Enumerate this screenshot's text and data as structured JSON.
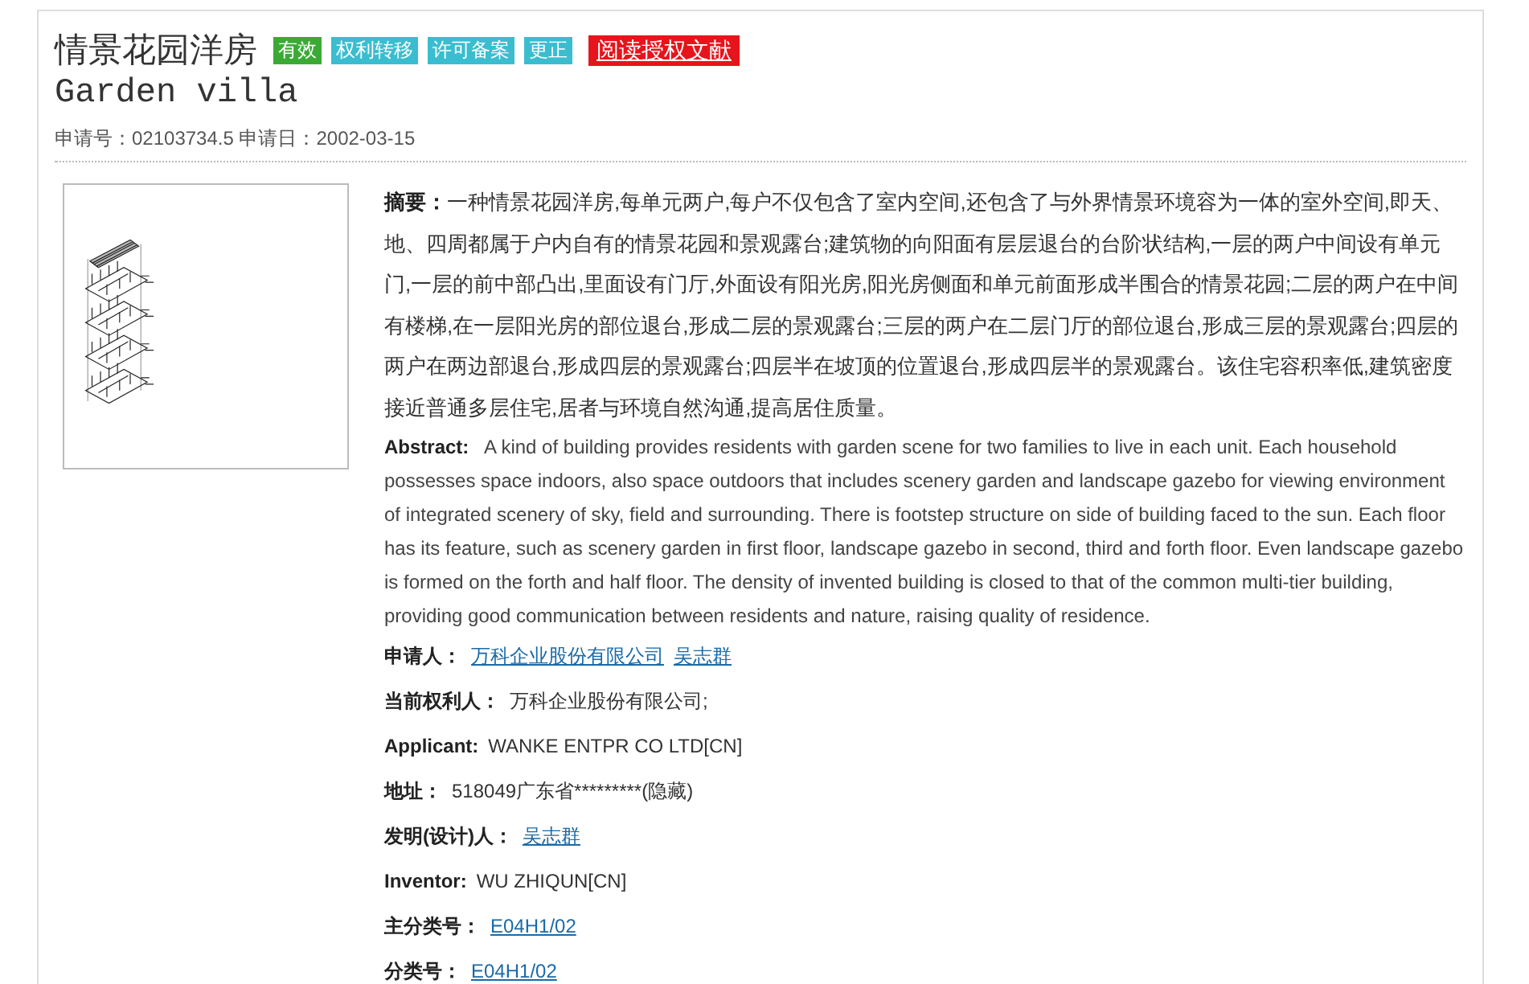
{
  "title": {
    "zh": "情景花园洋房",
    "en": "Garden villa"
  },
  "tags": [
    {
      "label": "有效",
      "color": "#3aaa35",
      "kind": "tag"
    },
    {
      "label": "权利转移",
      "color": "#3bbdd0",
      "kind": "tag"
    },
    {
      "label": "许可备案",
      "color": "#3bbdd0",
      "kind": "tag"
    },
    {
      "label": "更正",
      "color": "#3bbdd0",
      "kind": "tag"
    },
    {
      "label": "阅读授权文献",
      "color": "#e8141c",
      "kind": "link"
    }
  ],
  "meta": "申请号：02103734.5 申请日：2002-03-15",
  "figure": {
    "kind": "drawing"
  },
  "abstract_zh": {
    "label": "摘要：",
    "text": "一种情景花园洋房,每单元两户,每户不仅包含了室内空间,还包含了与外界情景环境容为一体的室外空间,即天、地、四周都属于户内自有的情景花园和景观露台;建筑物的向阳面有层层退台的台阶状结构,一层的两户中间设有单元门,一层的前中部凸出,里面设有门厅,外面设有阳光房,阳光房侧面和单元前面形成半围合的情景花园;二层的两户在中间有楼梯,在一层阳光房的部位退台,形成二层的景观露台;三层的两户在二层门厅的部位退台,形成三层的景观露台;四层的两户在两边部退台,形成四层的景观露台;四层半在坡顶的位置退台,形成四层半的景观露台。该住宅容积率低,建筑密度接近普通多层住宅,居者与环境自然沟通,提高居住质量。"
  },
  "abstract_en": {
    "label": "Abstract:",
    "text": "A kind of building provides residents with garden scene for two families to live in each unit. Each household possesses space indoors, also space outdoors that includes scenery garden and landscape gazebo for viewing environment of integrated scenery of sky, field and surrounding. There is footstep structure on side of building faced to the sun. Each floor has its feature, such as scenery garden in first floor, landscape gazebo in second, third and forth floor. Even landscape gazebo is formed on the forth and half floor. The density of invented building is closed to that of the common multi-tier building, providing good communication between residents and nature, raising quality of residence."
  },
  "fields": [
    {
      "label": "申请人：",
      "kind": "links",
      "values": [
        "万科企业股份有限公司",
        "吴志群"
      ]
    },
    {
      "label": "当前权利人：",
      "kind": "text",
      "values": [
        "万科企业股份有限公司;"
      ]
    },
    {
      "label": "Applicant:",
      "kind": "text",
      "values": [
        "WANKE ENTPR CO LTD[CN]"
      ]
    },
    {
      "label": "地址：",
      "kind": "text",
      "values": [
        "518049广东省*********(隐藏)"
      ]
    },
    {
      "label": "发明(设计)人：",
      "kind": "links",
      "values": [
        "吴志群"
      ]
    },
    {
      "label": "Inventor:",
      "kind": "text",
      "values": [
        "WU ZHIQUN[CN]"
      ]
    },
    {
      "label": "主分类号：",
      "kind": "links",
      "values": [
        "E04H1/02"
      ]
    },
    {
      "label": "分类号：",
      "kind": "links",
      "values": [
        "E04H1/02"
      ]
    }
  ]
}
